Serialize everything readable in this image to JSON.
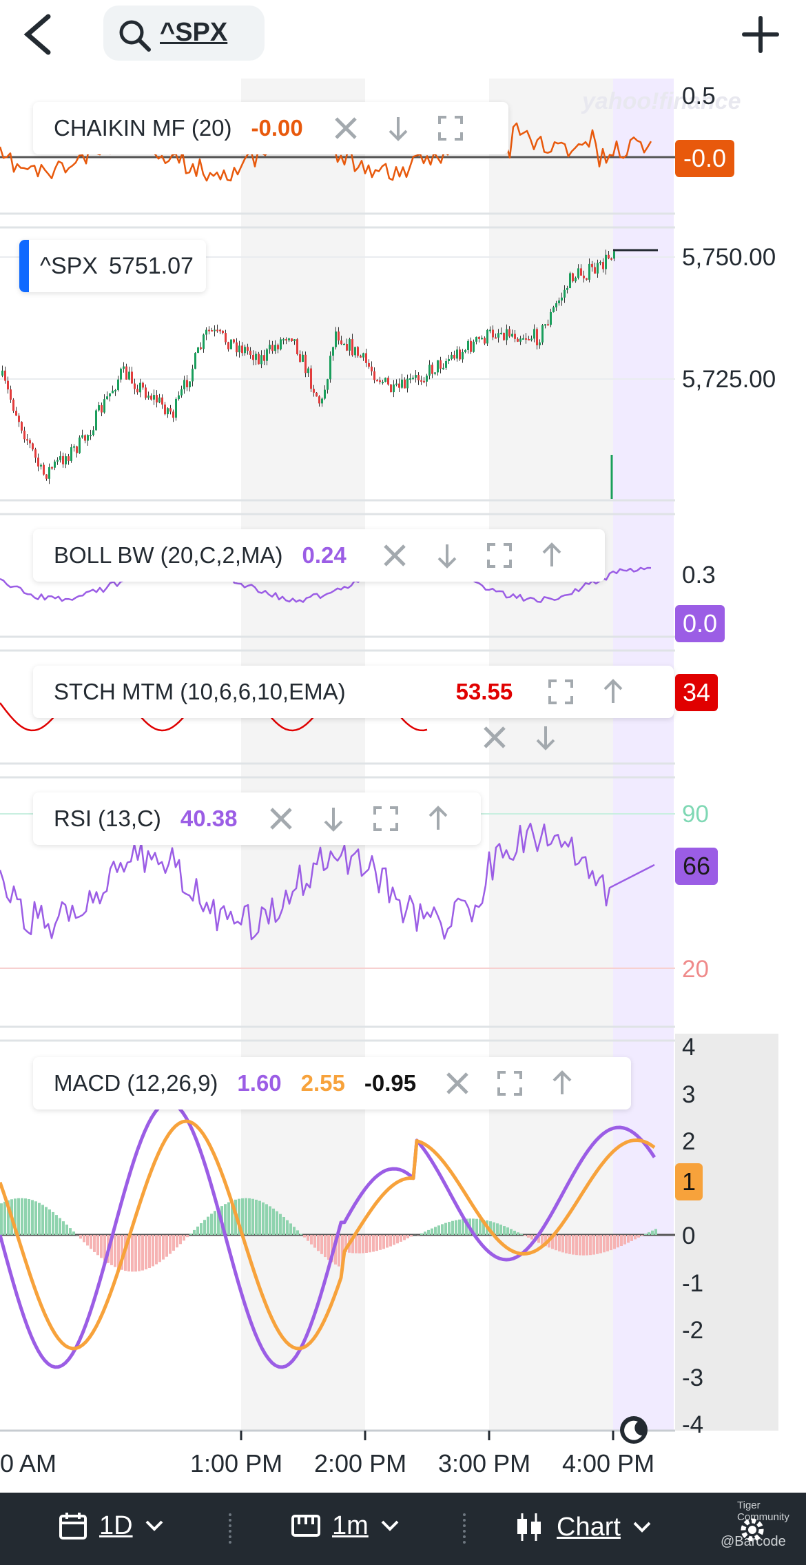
{
  "header": {
    "search_symbol": "^SPX"
  },
  "watermark": "yahoo!finance",
  "panels": {
    "chaikin": {
      "name": "CHAIKIN MF (20)",
      "value": "-0.00",
      "value_color": "#e8590c",
      "axis_top": "0.5",
      "badge": "-0.0"
    },
    "price": {
      "symbol": "^SPX",
      "price": "5751.07",
      "axis": [
        "5,750.00",
        "5,725.00"
      ]
    },
    "boll": {
      "name": "BOLL BW (20,C,2,MA)",
      "value": "0.24",
      "axis_top": "0.3",
      "badge": "0.0"
    },
    "stch": {
      "name": "STCH MTM (10,6,6,10,EMA)",
      "value": "53.55",
      "badge": "34"
    },
    "rsi": {
      "name": "RSI (13,C)",
      "value": "40.38",
      "axis_high": "90",
      "axis_low": "20",
      "badge": "66"
    },
    "macd": {
      "name": "MACD (12,26,9)",
      "v1": "1.60",
      "v2": "2.55",
      "v3": "-0.95",
      "badge": "1",
      "axis": [
        "4",
        "3",
        "2",
        "1",
        "0",
        "-1",
        "-2",
        "-3",
        "-4"
      ]
    }
  },
  "x_axis": [
    "0 AM",
    "1:00 PM",
    "2:00 PM",
    "3:00 PM",
    "4:00 PM"
  ],
  "bottom_bar": {
    "range": "1D",
    "interval": "1m",
    "chart_type": "Chart"
  },
  "branding": [
    "Tiger Community",
    "@Barcode"
  ],
  "icons": [
    "back-icon",
    "search-icon",
    "plus-icon",
    "close-icon",
    "arrow-down-icon",
    "expand-icon",
    "arrow-up-icon",
    "calendar-icon",
    "ruler-icon",
    "candlestick-icon",
    "chevron-down-icon",
    "gear-icon",
    "moon-icon"
  ],
  "colors": {
    "up": "#1a9e5c",
    "down": "#e23c3c",
    "chaikin": "#e8590c",
    "purple": "#9b5de5",
    "orange": "#f7a23b",
    "stch": "#e00000",
    "bg_bar": "#232a31"
  }
}
